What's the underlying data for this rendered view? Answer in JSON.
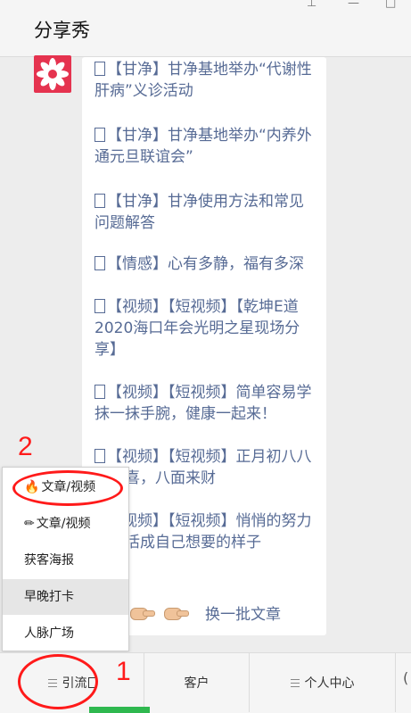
{
  "window": {
    "title": "分享秀",
    "pin_icon": "pin-icon",
    "minimize_icon": "minimize-icon",
    "maximize_icon": "maximize-icon"
  },
  "chat": {
    "avatar_icon": "flower-logo-icon",
    "messages": [
      "【甘净】甘净基地举办“代谢性肝病”义诊活动",
      "【甘净】甘净基地举办“内养外通元旦联谊会”",
      "【甘净】甘净使用方法和常见问题解答",
      "【情感】心有多静，福有多深",
      "【视频】【短视频】【乾坤E道2020海口年会光明之星现场分享】",
      "【视频】【短视频】简单容易学抹一抹手腕，健康一起来！",
      "【视频】【短视频】正月初八八方送喜，八面来财",
      "【视频】【短视频】悄悄的努力努力活成自己想要的样子"
    ],
    "more_label": "换一批文章"
  },
  "popup": {
    "items": [
      {
        "icon": "fire-icon",
        "glyph": "🔥",
        "label": "文章/视频"
      },
      {
        "icon": "pencil-icon",
        "glyph": "✏",
        "label": "文章/视频"
      },
      {
        "label": "获客海报"
      },
      {
        "label": "早晚打卡"
      },
      {
        "label": "人脉广场"
      }
    ]
  },
  "bottom_menu": {
    "tabs": [
      {
        "label": "引流",
        "has_menu_icon": true
      },
      {
        "label": "客户",
        "has_menu_icon": false
      },
      {
        "label": "个人中心",
        "has_menu_icon": true
      }
    ],
    "edge_glyph": "("
  },
  "annotations": {
    "label_1": "1",
    "label_2": "2",
    "color": "#ff1a1a"
  }
}
